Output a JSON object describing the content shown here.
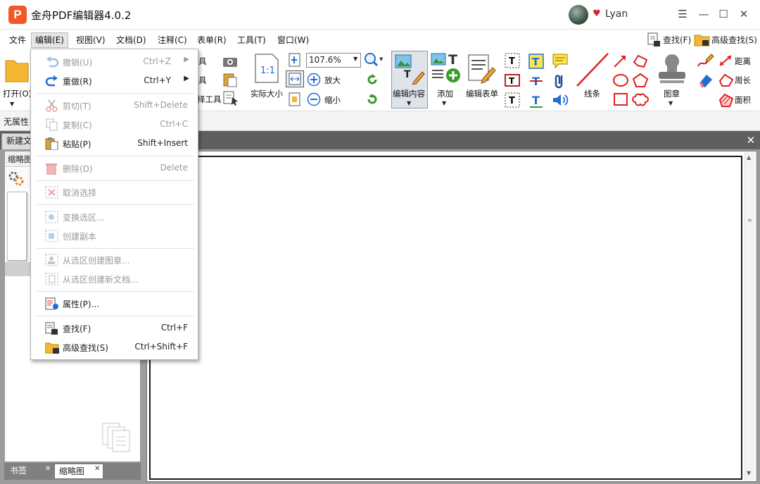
{
  "app": {
    "logo": "P",
    "title": "金舟PDF编辑器4.0.2",
    "user": "Lyan"
  },
  "menubar": [
    "文件",
    "编辑(E)",
    "视图(V)",
    "文档(D)",
    "注释(C)",
    "表单(R)",
    "工具(T)",
    "窗口(W)"
  ],
  "menubar_right": {
    "find": "查找(F)",
    "adv_find": "高级查找(S)"
  },
  "toolbar": {
    "open": "打开(O)",
    "tool_partial_1": "具",
    "tool_partial_2": "具",
    "tool_partial_3": "择工具",
    "actual_size": "实际大小",
    "zoom_value": "107.6%",
    "zoom_in": "放大",
    "zoom_out": "缩小",
    "edit_content": "编辑内容",
    "add": "添加",
    "edit_form": "编辑表单",
    "lines": "线条",
    "stamp": "图章",
    "distance": "距离",
    "perimeter": "周长",
    "area": "面积"
  },
  "propbar": {
    "text": "无属性"
  },
  "doc_tab": {
    "label": "新建文档"
  },
  "side_panel": {
    "header": "缩略图",
    "tabs": [
      "书签",
      "缩略图"
    ]
  },
  "edit_menu": [
    {
      "label": "撤销(U)",
      "shortcut": "Ctrl+Z",
      "arrow": true,
      "enabled": false,
      "icon": "undo-icon"
    },
    {
      "label": "重做(R)",
      "shortcut": "Ctrl+Y",
      "arrow": true,
      "enabled": true,
      "icon": "redo-icon"
    },
    {
      "label": "剪切(T)",
      "shortcut": "Shift+Delete",
      "enabled": false,
      "icon": "cut-icon"
    },
    {
      "label": "复制(C)",
      "shortcut": "Ctrl+C",
      "enabled": false,
      "icon": "copy-icon"
    },
    {
      "label": "粘贴(P)",
      "shortcut": "Shift+Insert",
      "enabled": true,
      "icon": "paste-icon"
    },
    {
      "label": "删除(D)",
      "shortcut": "Delete",
      "enabled": false,
      "icon": "delete-icon"
    },
    {
      "label": "取消选择",
      "shortcut": "",
      "enabled": false,
      "icon": "deselect-icon"
    },
    {
      "label": "变换选区...",
      "shortcut": "",
      "enabled": false,
      "icon": "transform-selection-icon"
    },
    {
      "label": "创建副本",
      "shortcut": "",
      "enabled": false,
      "icon": "duplicate-icon"
    },
    {
      "label": "从选区创建图章...",
      "shortcut": "",
      "enabled": false,
      "icon": "stamp-from-selection-icon"
    },
    {
      "label": "从选区创建新文档...",
      "shortcut": "",
      "enabled": false,
      "icon": "doc-from-selection-icon"
    },
    {
      "label": "属性(P)...",
      "shortcut": "",
      "enabled": true,
      "icon": "properties-icon"
    },
    {
      "label": "查找(F)",
      "shortcut": "Ctrl+F",
      "enabled": true,
      "icon": "find-icon"
    },
    {
      "label": "高级查找(S)",
      "shortcut": "Ctrl+Shift+F",
      "enabled": true,
      "icon": "advanced-find-icon"
    }
  ],
  "colors": {
    "brand": "#f05a28",
    "accent_blue": "#1f6fd1",
    "disabled": "#9a9a9a",
    "line_red": "#e02020"
  }
}
